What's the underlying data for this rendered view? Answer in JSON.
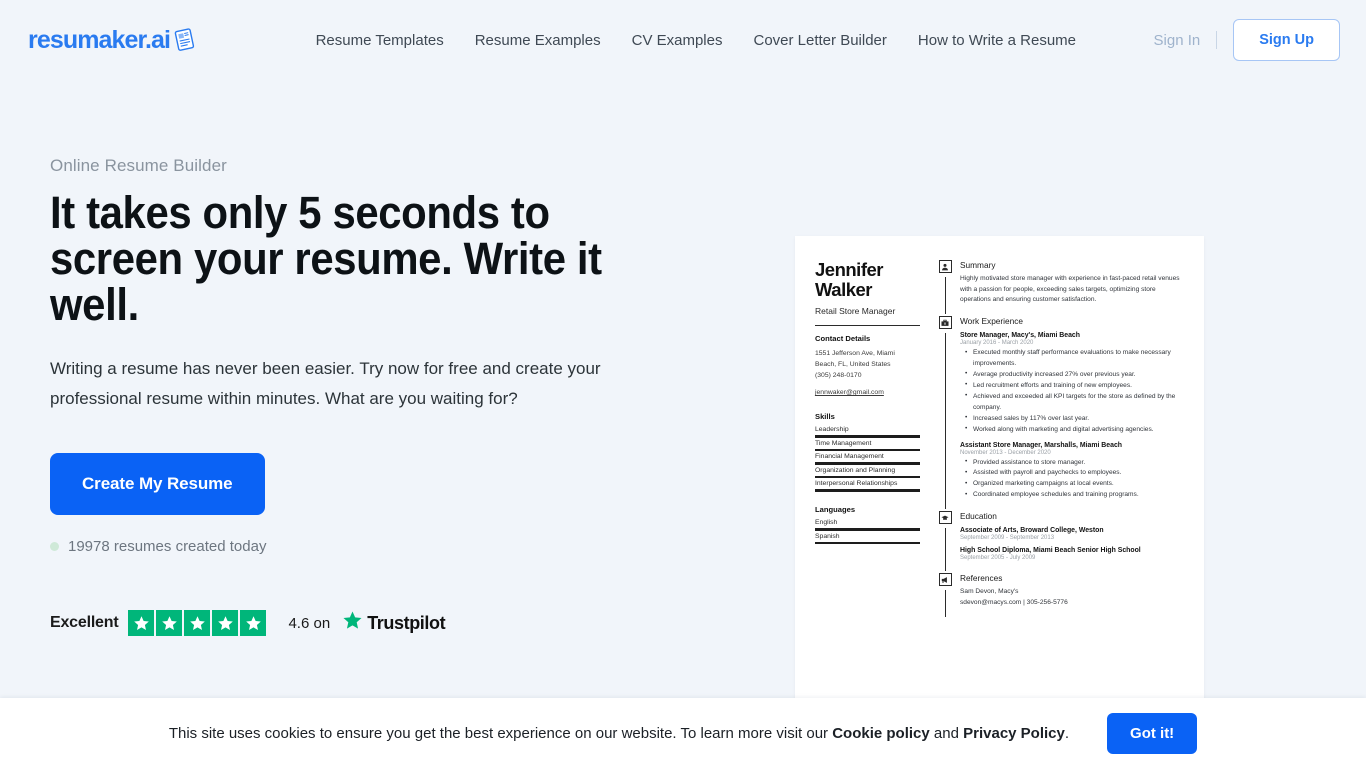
{
  "brand": {
    "name": "resumaker.ai",
    "accent": "#2a7bf0",
    "cta_color": "#0a62f5"
  },
  "nav": {
    "links": [
      {
        "label": "Resume Templates"
      },
      {
        "label": "Resume Examples"
      },
      {
        "label": "CV Examples"
      },
      {
        "label": "Cover Letter Builder"
      },
      {
        "label": "How to Write a Resume"
      }
    ],
    "sign_in": "Sign In",
    "sign_up": "Sign Up"
  },
  "hero": {
    "eyebrow": "Online Resume Builder",
    "headline": "It takes only 5 seconds to screen your resume. Write it well.",
    "subcopy": "Writing a resume has never been easier. Try now for free and create your professional resume within minutes. What are you waiting for?",
    "cta_label": "Create My Resume",
    "counter": "19978 resumes created today"
  },
  "trustpilot": {
    "word": "Excellent",
    "stars": 5,
    "star_color": "#00b67a",
    "score_text": "4.6 on",
    "brand": "Trustpilot"
  },
  "resume": {
    "name": "Jennifer Walker",
    "job_title": "Retail Store Manager",
    "contact": {
      "heading": "Contact Details",
      "address_line1": "1551 Jefferson Ave, Miami",
      "address_line2": "Beach, FL, United States",
      "phone": "(305) 248-0170",
      "email": "jennwaker@gmail.com"
    },
    "skills": {
      "heading": "Skills",
      "items": [
        {
          "label": "Leadership",
          "level": 100
        },
        {
          "label": "Time Management",
          "level": 100
        },
        {
          "label": "Financial Management",
          "level": 100
        },
        {
          "label": "Organization and Planning",
          "level": 100
        },
        {
          "label": "Interpersonal Relationships",
          "level": 100
        }
      ]
    },
    "languages": {
      "heading": "Languages",
      "items": [
        {
          "label": "English",
          "level": 100
        },
        {
          "label": "Spanish",
          "level": 100
        }
      ]
    },
    "summary": {
      "heading": "Summary",
      "text": "Highly motivated store manager with experience in fast-paced retail venues with a passion for people, exceeding sales targets, optimizing store operations and ensuring customer satisfaction."
    },
    "work": {
      "heading": "Work Experience",
      "jobs": [
        {
          "title": "Store Manager, Macy's, Miami Beach",
          "dates": "January 2016 - March 2020",
          "bullets": [
            "Executed monthly staff performance evaluations to make necessary improvements.",
            "Average productivity increased 27% over previous year.",
            "Led recruitment efforts and training of new employees.",
            "Achieved and exceeded all KPI targets for the store as defined by the company.",
            "Increased sales by 117% over last year.",
            "Worked along with marketing and digital advertising agencies."
          ]
        },
        {
          "title": "Assistant Store Manager, Marshalls, Miami Beach",
          "dates": "November 2013 - December 2020",
          "bullets": [
            "Provided assistance to store manager.",
            "Assisted with payroll and paychecks to employees.",
            "Organized marketing campaigns at local events.",
            "Coordinated employee schedules and training programs."
          ]
        }
      ]
    },
    "education": {
      "heading": "Education",
      "entries": [
        {
          "title": "Associate of Arts, Broward College, Weston",
          "dates": "September 2009 - September 2013"
        },
        {
          "title": "High School Diploma, Miami Beach Senior High School",
          "dates": "September 2005 - July 2009"
        }
      ]
    },
    "references": {
      "heading": "References",
      "name": "Sam Devon, Macy's",
      "detail": "sdevon@macys.com | 305-256-5776"
    }
  },
  "cookie": {
    "text_before": "This site uses cookies to ensure you get the best experience on our website. To learn more visit our ",
    "link1": "Cookie policy",
    "text_mid": " and ",
    "link2": "Privacy Policy",
    "text_after": ".",
    "button": "Got it!"
  }
}
